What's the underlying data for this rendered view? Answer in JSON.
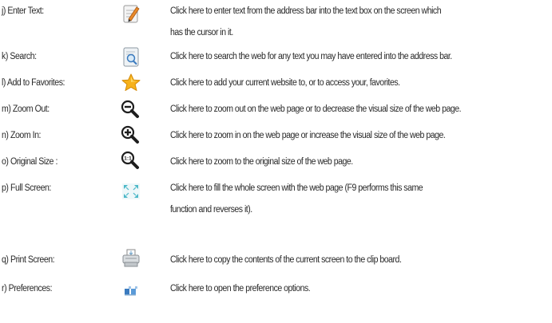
{
  "items": [
    {
      "label": "j) Enter Text:",
      "icon": "enter-text-icon",
      "desc_line1": "Click here to enter text from the address bar into the text box on the screen which",
      "desc_line2": "has the cursor in it."
    },
    {
      "label": "k) Search:",
      "icon": "search-icon",
      "desc_line1": "Click here to search the web for any text you may have entered into the address bar."
    },
    {
      "label": "l) Add to Favorites:",
      "icon": "star-icon",
      "desc_line1": "Click here to add your current website to, or to access your, favorites."
    },
    {
      "label": "m) Zoom Out:",
      "icon": "zoom-out-icon",
      "desc_line1": "Click here to zoom out on the web page or to decrease the visual size of the web page."
    },
    {
      "label": "n) Zoom In:",
      "icon": "zoom-in-icon",
      "desc_line1": "Click here to zoom in on the web page or increase the visual size of the web page."
    },
    {
      "label": "o) Original Size :",
      "icon": "original-size-icon",
      "icon_text": "1:1",
      "desc_line1": "Click here to zoom to the original size of the web page."
    },
    {
      "label": "p) Full Screen:",
      "icon": "full-screen-icon",
      "desc_line1": "Click here to fill the whole screen with the web page (F9 performs this same",
      "desc_line2": "function and reverses it)."
    },
    {
      "label": "q) Print Screen:",
      "icon": "print-screen-icon",
      "desc_line1": "Click here to copy the contents of the current screen to the clip board."
    },
    {
      "label": "r)  Preferences:",
      "icon": "preferences-icon",
      "desc_line1": "Click here to open the preference options."
    }
  ],
  "colors": {
    "text": "#2a2a2a",
    "star": "#f7b21b",
    "icon_blue": "#3b7bbf",
    "icon_teal": "#4cb8c8"
  }
}
